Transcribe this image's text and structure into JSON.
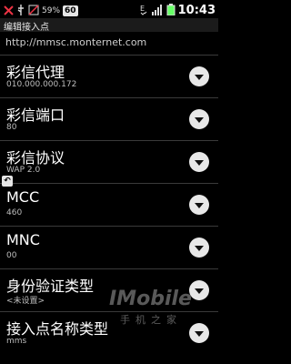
{
  "statusbar": {
    "battery_percent": "59%",
    "badge": "60",
    "time": "10:43"
  },
  "header": {
    "title": "编辑接入点"
  },
  "partial_value": "http://mmsc.monternet.com",
  "items": [
    {
      "title": "彩信代理",
      "value": "010.000.000.172"
    },
    {
      "title": "彩信端口",
      "value": "80"
    },
    {
      "title": "彩信协议",
      "value": "WAP 2.0"
    },
    {
      "title": "MCC",
      "value": "460"
    },
    {
      "title": "MNC",
      "value": "00"
    },
    {
      "title": "身份验证类型",
      "value": "<未设置>"
    },
    {
      "title": "接入点名称类型",
      "value": "mms"
    }
  ],
  "watermark": {
    "logo": "IMobile",
    "sub": "手机之家"
  },
  "icons": {
    "left": [
      "missed-call-icon",
      "usb-icon",
      "no-sim-icon"
    ],
    "right": [
      "data-icon",
      "signal-icon",
      "battery-icon"
    ],
    "dropdown": "chevron-down-icon"
  }
}
